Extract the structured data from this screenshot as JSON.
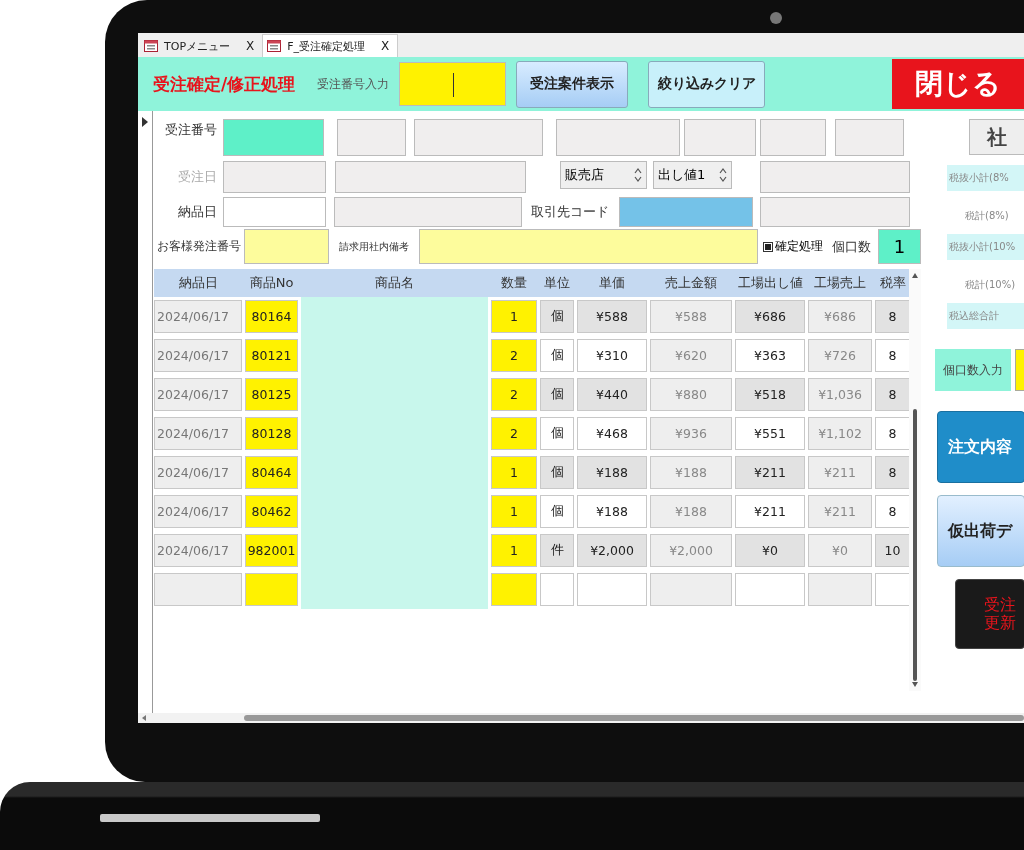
{
  "tabs": [
    {
      "label": "TOPメニュー",
      "close": "X",
      "selected": false
    },
    {
      "label": "F_受注確定処理",
      "close": "X",
      "selected": true
    }
  ],
  "header": {
    "title": "受注確定/修正処理",
    "order_label": "受注番号入力",
    "buttons": [
      {
        "label": "受注案件表示",
        "kind": "primary"
      },
      {
        "label": "絞り込みクリア",
        "kind": "light"
      }
    ],
    "close_button": "閉じる"
  },
  "form": {
    "rows": [
      {
        "items": [
          {
            "kind": "label",
            "text": "受注番号",
            "disabled": false
          },
          {
            "kind": "key"
          },
          {
            "kind": "readonly"
          },
          {
            "kind": "readonly"
          },
          {
            "kind": "readonly"
          },
          {
            "kind": "readonly"
          },
          {
            "kind": "readonly"
          },
          {
            "kind": "readonly"
          }
        ]
      },
      {
        "items": [
          {
            "kind": "label",
            "text": "受注日",
            "disabled": true
          },
          {
            "kind": "readonly"
          },
          {
            "kind": "readonly"
          },
          {
            "kind": "select",
            "value": "販売店"
          },
          {
            "kind": "select",
            "value": "出し値1"
          },
          {
            "kind": "readonly"
          }
        ]
      },
      {
        "items": [
          {
            "kind": "label",
            "text": "納品日",
            "disabled": false
          },
          {
            "kind": "input"
          },
          {
            "kind": "readonly"
          },
          {
            "kind": "label",
            "text": "取引先コード",
            "disabled": false
          },
          {
            "kind": "lookup"
          },
          {
            "kind": "readonly"
          }
        ]
      },
      {
        "items": [
          {
            "kind": "label",
            "text": "お客様発注番号",
            "disabled": false
          },
          {
            "kind": "note"
          },
          {
            "kind": "label",
            "text": "請求用社内備考",
            "disabled": false
          },
          {
            "kind": "note"
          },
          {
            "kind": "check",
            "text": "確定処理",
            "checked": true
          },
          {
            "kind": "label",
            "text": "個口数",
            "disabled": false
          },
          {
            "kind": "key",
            "value": "1"
          }
        ]
      }
    ]
  },
  "summary": {
    "button": "社",
    "labels": [
      {
        "text": "税抜小計(8%",
        "kind": "boxed"
      },
      {
        "text": "税計(8%)",
        "kind": "plain"
      },
      {
        "text": "税抜小計(10%",
        "kind": "boxed"
      },
      {
        "text": "税計(10%)",
        "kind": "plain"
      },
      {
        "text": "税込総合計",
        "kind": "boxed"
      }
    ],
    "parcel_label": "個口数入力",
    "actions": [
      {
        "kind": "primary",
        "lines": [
          "注文内容"
        ]
      },
      {
        "kind": "secondary",
        "lines": [
          "仮出荷デ"
        ]
      },
      {
        "kind": "danger",
        "lines": [
          "受注",
          "更新"
        ]
      }
    ]
  },
  "table": {
    "columns": [
      {
        "label": "納品日",
        "kind": "readonly"
      },
      {
        "label": "商品No",
        "kind": "key"
      },
      {
        "label": "商品名",
        "kind": "masked"
      },
      {
        "label": "数量",
        "kind": "key"
      },
      {
        "label": "単位",
        "kind": "edit"
      },
      {
        "label": "単価",
        "kind": "edit"
      },
      {
        "label": "売上金額",
        "kind": "calc"
      },
      {
        "label": "工場出し値",
        "kind": "edit"
      },
      {
        "label": "工場売上",
        "kind": "calc"
      },
      {
        "label": "税率",
        "kind": "edit"
      }
    ],
    "rows": [
      {
        "shaded": true,
        "date": "2024/06/17",
        "product_no": "80164",
        "qty": "1",
        "unit": "個",
        "unit_price": "¥588",
        "sales": "¥588",
        "factory_price": "¥686",
        "factory_sales": "¥686",
        "tax_rate": "8"
      },
      {
        "shaded": false,
        "date": "2024/06/17",
        "product_no": "80121",
        "qty": "2",
        "unit": "個",
        "unit_price": "¥310",
        "sales": "¥620",
        "factory_price": "¥363",
        "factory_sales": "¥726",
        "tax_rate": "8"
      },
      {
        "shaded": true,
        "date": "2024/06/17",
        "product_no": "80125",
        "qty": "2",
        "unit": "個",
        "unit_price": "¥440",
        "sales": "¥880",
        "factory_price": "¥518",
        "factory_sales": "¥1,036",
        "tax_rate": "8"
      },
      {
        "shaded": false,
        "date": "2024/06/17",
        "product_no": "80128",
        "qty": "2",
        "unit": "個",
        "unit_price": "¥468",
        "sales": "¥936",
        "factory_price": "¥551",
        "factory_sales": "¥1,102",
        "tax_rate": "8"
      },
      {
        "shaded": true,
        "date": "2024/06/17",
        "product_no": "80464",
        "qty": "1",
        "unit": "個",
        "unit_price": "¥188",
        "sales": "¥188",
        "factory_price": "¥211",
        "factory_sales": "¥211",
        "tax_rate": "8"
      },
      {
        "shaded": false,
        "date": "2024/06/17",
        "product_no": "80462",
        "qty": "1",
        "unit": "個",
        "unit_price": "¥188",
        "sales": "¥188",
        "factory_price": "¥211",
        "factory_sales": "¥211",
        "tax_rate": "8"
      },
      {
        "shaded": true,
        "date": "2024/06/17",
        "product_no": "982001",
        "qty": "1",
        "unit": "件",
        "unit_price": "¥2,000",
        "sales": "¥2,000",
        "factory_price": "¥0",
        "factory_sales": "¥0",
        "tax_rate": "10"
      }
    ],
    "new_record_row": true
  }
}
